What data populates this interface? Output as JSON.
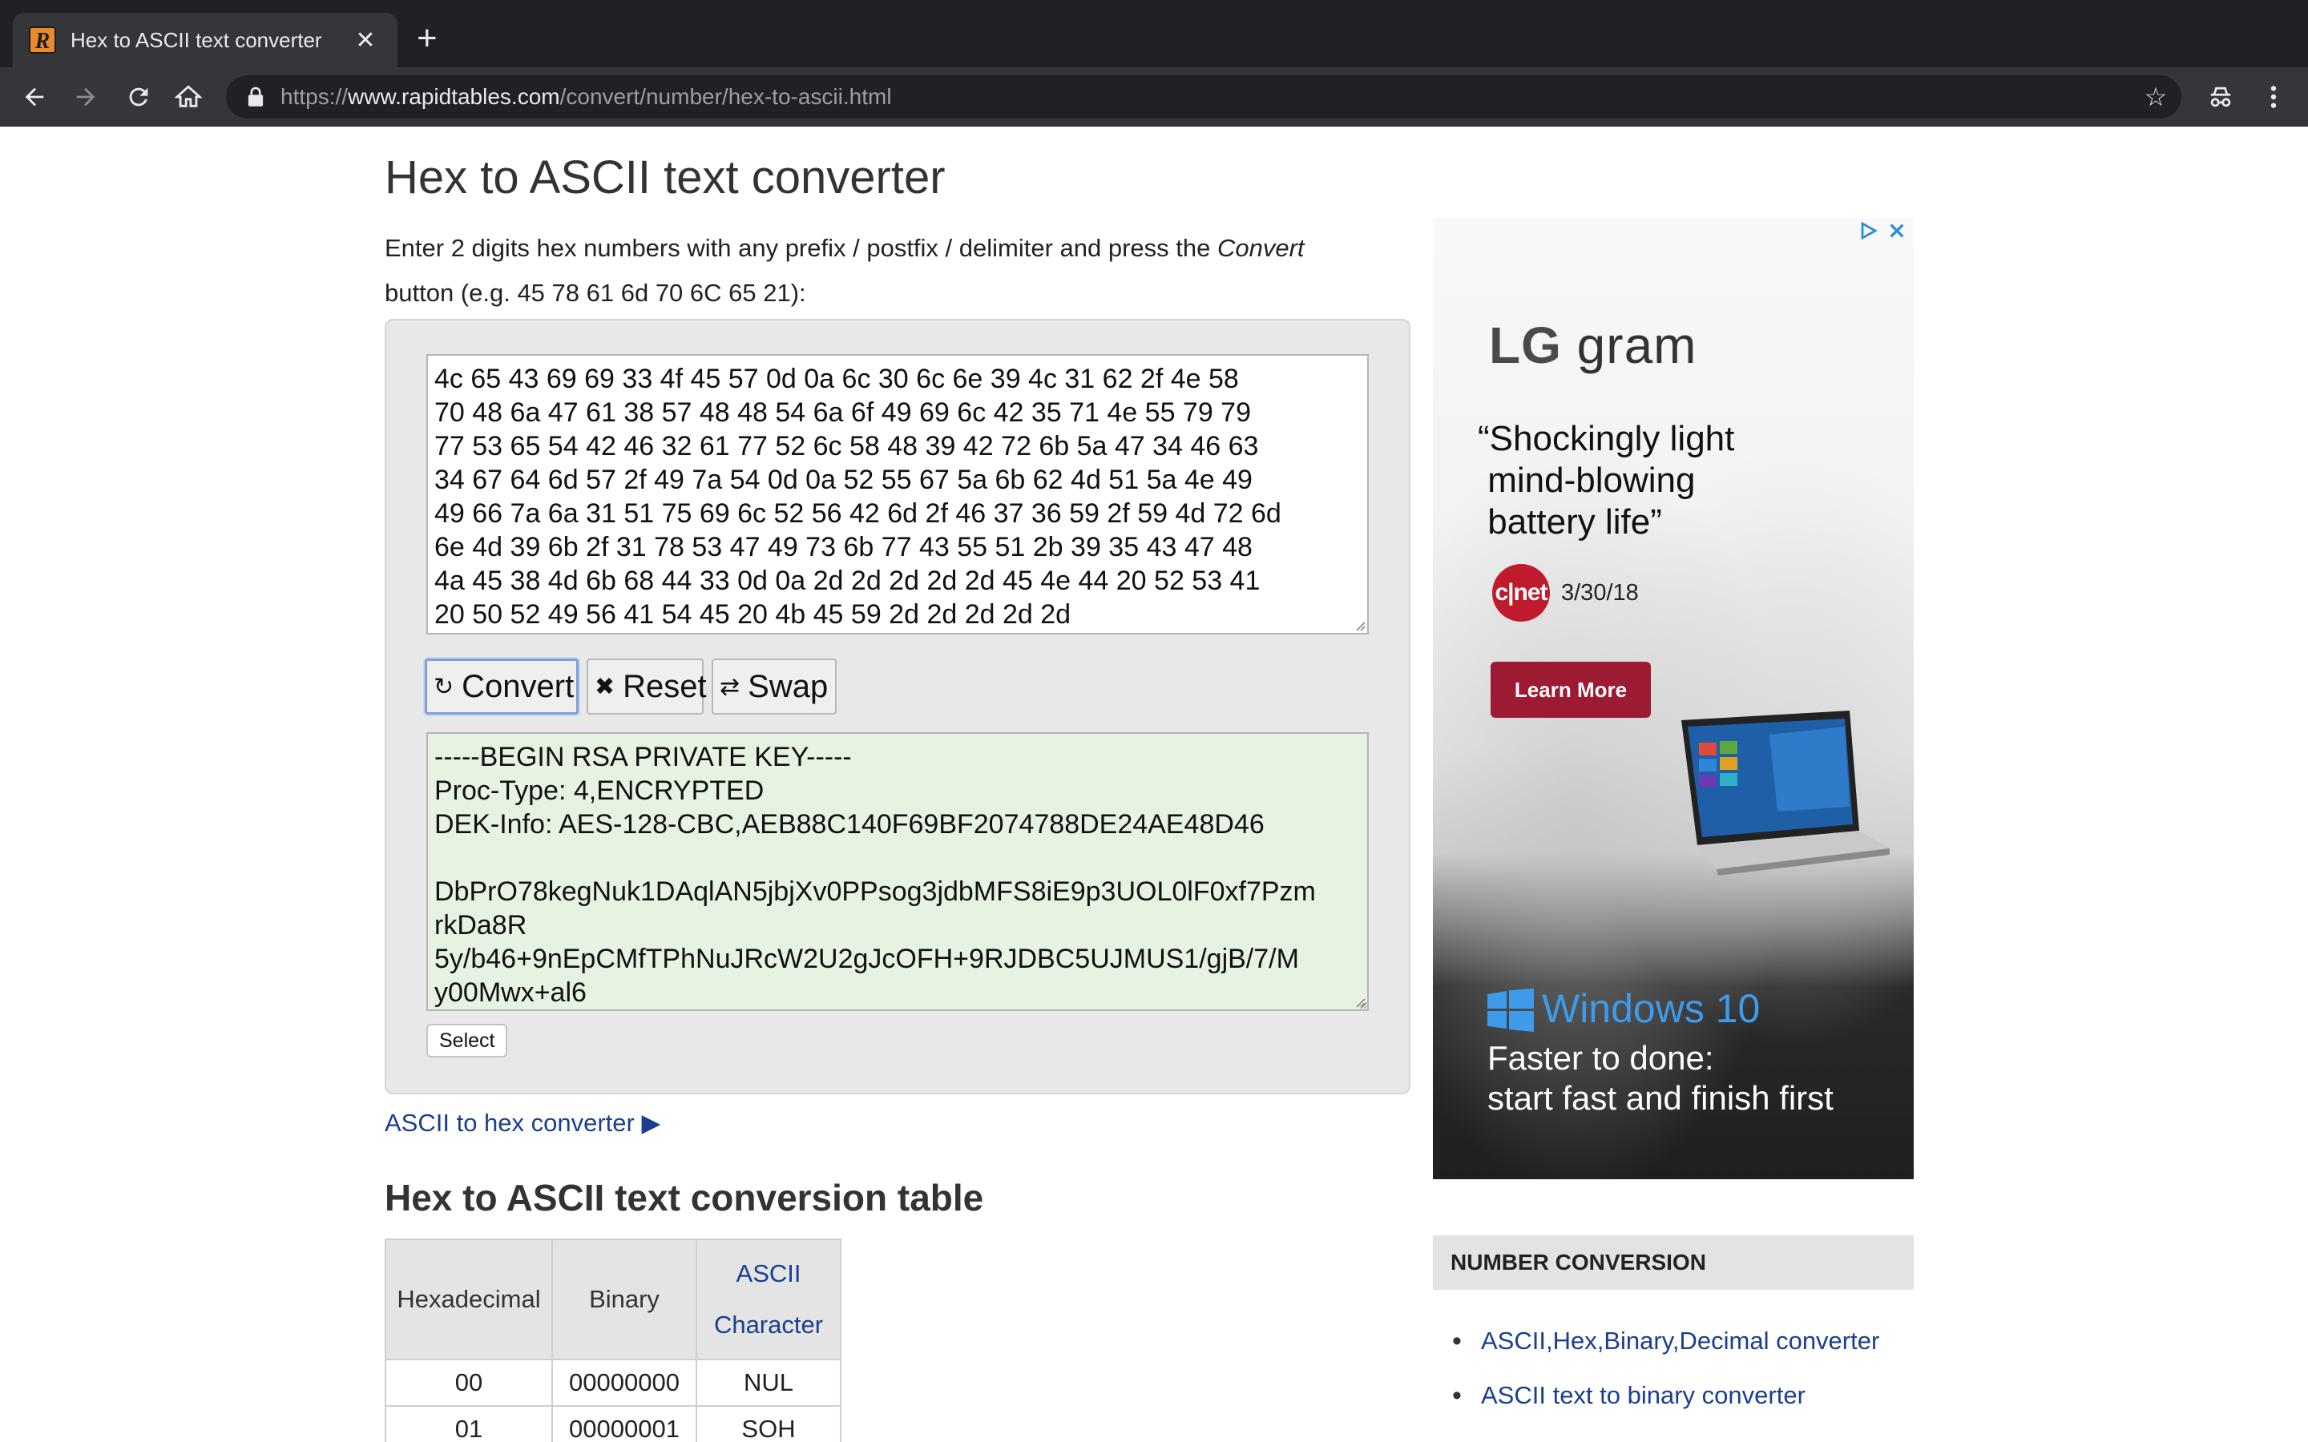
{
  "browser": {
    "tab_title": "Hex to ASCII text converter",
    "url_scheme": "https://",
    "url_host": "www.rapidtables.com",
    "url_path": "/convert/number/hex-to-ascii.html"
  },
  "page": {
    "title": "Hex to ASCII text converter",
    "intro_before": "Enter 2 digits hex numbers with any prefix / postfix / delimiter and press the ",
    "intro_em": "Convert",
    "intro_after": " button (e.g. 45 78 61 6d 70 6C 65 21):"
  },
  "converter": {
    "hex_input": "4c 65 43 69 69 33 4f 45 57 0d 0a 6c 30 6c 6e 39 4c 31 62 2f 4e 58\n70 48 6a 47 61 38 57 48 48 54 6a 6f 49 69 6c 42 35 71 4e 55 79 79\n77 53 65 54 42 46 32 61 77 52 6c 58 48 39 42 72 6b 5a 47 34 46 63\n34 67 64 6d 57 2f 49 7a 54 0d 0a 52 55 67 5a 6b 62 4d 51 5a 4e 49\n49 66 7a 6a 31 51 75 69 6c 52 56 42 6d 2f 46 37 36 59 2f 59 4d 72 6d\n6e 4d 39 6b 2f 31 78 53 47 49 73 6b 77 43 55 51 2b 39 35 43 47 48\n4a 45 38 4d 6b 68 44 33 0d 0a 2d 2d 2d 2d 2d 45 4e 44 20 52 53 41\n20 50 52 49 56 41 54 45 20 4b 45 59 2d 2d 2d 2d 2d",
    "convert_label": "Convert",
    "reset_label": "Reset",
    "swap_label": "Swap",
    "ascii_output": "-----BEGIN RSA PRIVATE KEY-----\nProc-Type: 4,ENCRYPTED\nDEK-Info: AES-128-CBC,AEB88C140F69BF2074788DE24AE48D46\n\nDbPrO78kegNuk1DAqlAN5jbjXv0PPsog3jdbMFS8iE9p3UOL0lF0xf7Pzm\nrkDa8R\n5y/b46+9nEpCMfTPhNuJRcW2U2gJcOFH+9RJDBC5UJMUS1/gjB/7/M\ny00Mwx+al6",
    "select_label": "Select"
  },
  "links": {
    "ascii_to_hex": "ASCII to hex converter ▶"
  },
  "table": {
    "title": "Hex to ASCII text conversion table",
    "col_hex": "Hexadecimal",
    "col_bin": "Binary",
    "col_ascii_1": "ASCII",
    "col_ascii_2": "Character",
    "rows": [
      {
        "hex": "00",
        "bin": "00000000",
        "ascii": "NUL"
      },
      {
        "hex": "01",
        "bin": "00000001",
        "ascii": "SOH"
      }
    ]
  },
  "ad": {
    "brand_bold": "LG",
    "brand_rest": " gram",
    "quote": "“Shockingly light\n mind-blowing\n battery life”",
    "cnet": "c|net",
    "date": "3/30/18",
    "learn_more": "Learn More",
    "windows": "Windows 10",
    "tagline": "Faster to done:\nstart fast and finish first"
  },
  "sidebar": {
    "heading": "NUMBER CONVERSION",
    "items": [
      "ASCII,Hex,Binary,Decimal converter",
      "ASCII text to binary converter"
    ]
  },
  "colors": {
    "link": "#1a3f8f",
    "output_bg": "#e6f2e2",
    "learn_more_bg": "#9c1b33",
    "windows_blue": "#3d9be9"
  }
}
